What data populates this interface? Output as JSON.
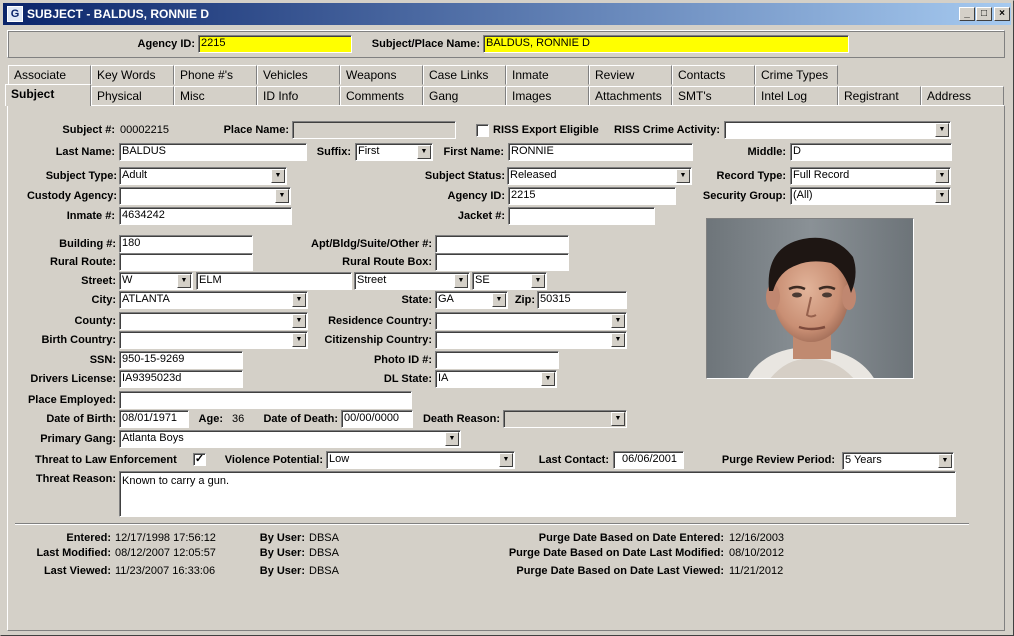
{
  "window": {
    "title": "SUBJECT - BALDUS, RONNIE D",
    "app_icon": "app-icon",
    "minimize": "_",
    "maximize": "□",
    "close": "×"
  },
  "header": {
    "agency_id_label": "Agency ID:",
    "agency_id": "2215",
    "subject_place_label": "Subject/Place Name:",
    "subject_place": "BALDUS, RONNIE  D"
  },
  "tabs_row1": [
    "Associate",
    "Key Words",
    "Phone #'s",
    "Vehicles",
    "Weapons",
    "Case Links",
    "Inmate",
    "Review",
    "Contacts",
    "Crime Types"
  ],
  "tabs_row2": [
    "Subject",
    "Physical",
    "Misc",
    "ID Info",
    "Comments",
    "Gang",
    "Images",
    "Attachments",
    "SMT's",
    "Intel Log",
    "Registrant",
    "Address"
  ],
  "form": {
    "subject_no_label": "Subject #:",
    "subject_no": "00002215",
    "place_name_label": "Place Name:",
    "place_name": "",
    "riss_export_label": "RISS Export Eligible",
    "riss_export_checked": "",
    "riss_crime_label": "RISS Crime Activity:",
    "riss_crime": "",
    "last_name_label": "Last Name:",
    "last_name": "BALDUS",
    "suffix_label": "Suffix:",
    "suffix": "First",
    "first_name_label": "First Name:",
    "first_name": "RONNIE",
    "middle_label": "Middle:",
    "middle": "D",
    "subject_type_label": "Subject Type:",
    "subject_type": "Adult",
    "subject_status_label": "Subject Status:",
    "subject_status": "Released",
    "record_type_label": "Record Type:",
    "record_type": "Full Record",
    "custody_agency_label": "Custody Agency:",
    "custody_agency": "",
    "agency_id_label": "Agency ID:",
    "agency_id": "2215",
    "security_group_label": "Security Group:",
    "security_group": "(All)",
    "inmate_label": "Inmate #:",
    "inmate": "4634242",
    "jacket_label": "Jacket #:",
    "jacket": "",
    "building_label": "Building #:",
    "building": "180",
    "apt_label": "Apt/Bldg/Suite/Other #:",
    "apt": "",
    "rural_route_label": "Rural Route:",
    "rural_route": "",
    "rural_box_label": "Rural Route Box:",
    "rural_box": "",
    "street_label": "Street:",
    "street_dir": "W",
    "street_name": "ELM",
    "street_type": "Street",
    "street_post_dir": "SE",
    "city_label": "City:",
    "city": "ATLANTA",
    "state_label": "State:",
    "state": "GA",
    "zip_label": "Zip:",
    "zip": "50315",
    "county_label": "County:",
    "county": "",
    "res_country_label": "Residence Country:",
    "res_country": "",
    "birth_country_label": "Birth Country:",
    "birth_country": "",
    "cit_country_label": "Citizenship Country:",
    "cit_country": "",
    "ssn_label": "SSN:",
    "ssn": "950-15-9269",
    "photo_id_label": "Photo ID #:",
    "photo_id": "",
    "dl_label": "Drivers License:",
    "dl": "IA9395023d",
    "dl_state_label": "DL State:",
    "dl_state": "IA",
    "place_employed_label": "Place Employed:",
    "place_employed": "",
    "dob_label": "Date of Birth:",
    "dob": "08/01/1971",
    "age_label": "Age:",
    "age": "36",
    "dod_label": "Date of Death:",
    "dod": "00/00/0000",
    "death_reason_label": "Death Reason:",
    "death_reason": "",
    "primary_gang_label": "Primary Gang:",
    "primary_gang": "Atlanta Boys",
    "threat_le_label": "Threat to Law Enforcement",
    "threat_le_checked": "✓",
    "violence_label": "Violence Potential:",
    "violence": "Low",
    "last_contact_label": "Last Contact:",
    "last_contact": "06/06/2001",
    "purge_review_label": "Purge Review Period:",
    "purge_review": "5 Years",
    "threat_reason_label": "Threat Reason:",
    "threat_reason": "Known to carry a gun."
  },
  "footer": {
    "entered_label": "Entered:",
    "entered": "12/17/1998 17:56:12",
    "by_user_label": "By User:",
    "entered_by": "DBSA",
    "modified_label": "Last Modified:",
    "modified": "08/12/2007 12:05:57",
    "modified_by": "DBSA",
    "viewed_label": "Last Viewed:",
    "viewed": "11/23/2007 16:33:06",
    "viewed_by": "DBSA",
    "purge_entered_label": "Purge Date Based on Date Entered:",
    "purge_entered": "12/16/2003",
    "purge_modified_label": "Purge Date Based on Date Last Modified:",
    "purge_modified": "08/10/2012",
    "purge_viewed_label": "Purge Date Based on Date Last Viewed:",
    "purge_viewed": "11/21/2012"
  },
  "dropdown_arrow": "▼"
}
